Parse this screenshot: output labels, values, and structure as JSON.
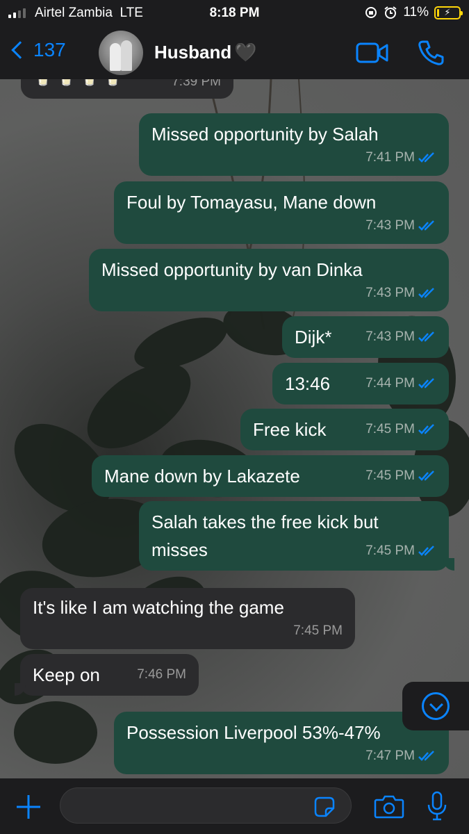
{
  "status_bar": {
    "carrier": "Airtel Zambia",
    "network": "LTE",
    "time": "8:18 PM",
    "battery": "11%",
    "battery_level": 0.11
  },
  "header": {
    "back_count": "137",
    "contact_name": "Husband",
    "contact_emoji": "🖤",
    "video_icon": "video-camera-icon",
    "call_icon": "phone-icon"
  },
  "colors": {
    "accent": "#0a84ff",
    "outgoing_bubble": "#1f4a3e",
    "incoming_bubble": "#2b2b2d",
    "bar_background": "#1c1c1e"
  },
  "messages": [
    {
      "dir": "in",
      "text": "🥛 🥛 🥛 🥛",
      "time": "7:39 PM",
      "read": false
    },
    {
      "dir": "out",
      "text": "Missed opportunity by Salah",
      "time": "7:41 PM",
      "read": true
    },
    {
      "dir": "out",
      "text": "Foul by Tomayasu, Mane down",
      "time": "7:43 PM",
      "read": true
    },
    {
      "dir": "out",
      "text": "Missed opportunity by van Dinka",
      "time": "7:43 PM",
      "read": true
    },
    {
      "dir": "out",
      "text": "Dijk*",
      "time": "7:43 PM",
      "read": true
    },
    {
      "dir": "out",
      "text": "13:46",
      "time": "7:44 PM",
      "read": true
    },
    {
      "dir": "out",
      "text": "Free kick",
      "time": "7:45 PM",
      "read": true
    },
    {
      "dir": "out",
      "text": "Mane down by Lakazete",
      "time": "7:45 PM",
      "read": true
    },
    {
      "dir": "out",
      "text": "Salah takes the free kick but\nmisses",
      "time": "7:45 PM",
      "read": true
    },
    {
      "dir": "in",
      "text": "It's like I am watching the game",
      "time": "7:45 PM",
      "read": false
    },
    {
      "dir": "in",
      "text": "Keep on",
      "time": "7:46 PM",
      "read": false
    },
    {
      "dir": "out",
      "text": "Possession Liverpool 53%-47%",
      "time": "7:47 PM",
      "read": true
    }
  ],
  "input": {
    "value": "",
    "plus_icon": "plus-icon",
    "sticker_icon": "sticker-icon",
    "camera_icon": "camera-icon",
    "mic_icon": "microphone-icon"
  }
}
